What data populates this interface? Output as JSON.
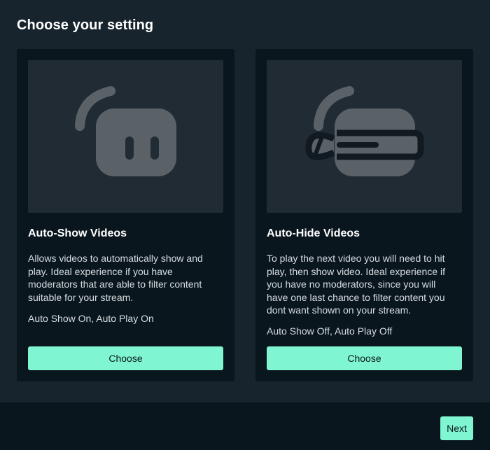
{
  "page": {
    "title": "Choose your setting"
  },
  "options": [
    {
      "illustration": "robot-eyes-icon",
      "title": "Auto-Show Videos",
      "description": "Allows videos to automatically show and play. Ideal experience if you have moderators that are able to filter content suitable for your stream.",
      "setting": "Auto Show On, Auto Play On",
      "button_label": "Choose"
    },
    {
      "illustration": "robot-blindfolded-icon",
      "title": "Auto-Hide Videos",
      "description": "To play the next video you will need to hit play, then show video. Ideal experience if you have no moderators, since you will have one last chance to filter content you dont want shown on your stream.",
      "setting": "Auto Show Off, Auto Play Off",
      "button_label": "Choose"
    }
  ],
  "footer": {
    "next_label": "Next"
  },
  "colors": {
    "background": "#17242d",
    "card": "#0a161d",
    "illustration_bg": "#202b34",
    "accent": "#80f5d2",
    "icon": "#5a6268"
  }
}
